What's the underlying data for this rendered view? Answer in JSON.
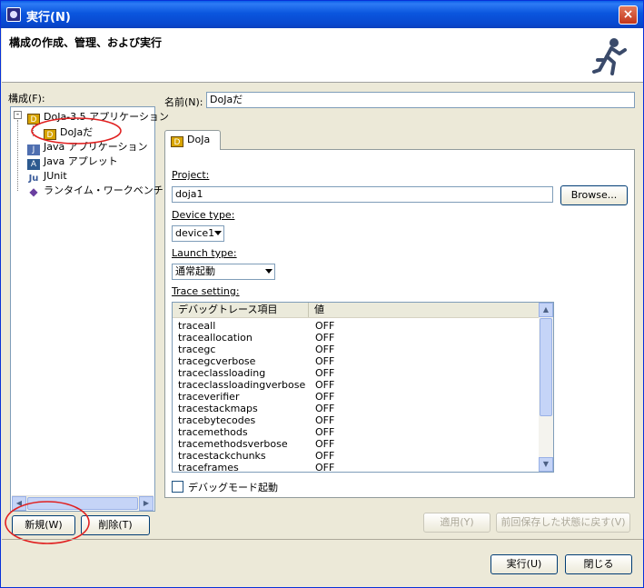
{
  "window": {
    "title": "実行(N)",
    "close": "×"
  },
  "banner": {
    "title": "構成の作成、管理、および実行"
  },
  "tree": {
    "label": "構成(F):",
    "items": [
      {
        "label": "DoJa-3.5 アプリケーション",
        "icon": "doja-icon"
      },
      {
        "label": "DoJaだ",
        "icon": "doja-icon"
      },
      {
        "label": "Java アプリケーション",
        "icon": "java-app-icon"
      },
      {
        "label": "Java アプレット",
        "icon": "java-applet-icon"
      },
      {
        "label": "JUnit",
        "icon": "junit-icon"
      },
      {
        "label": "ランタイム・ワークベンチ",
        "icon": "runtime-workbench-icon"
      }
    ]
  },
  "buttons": {
    "new": "新規(W)",
    "delete": "削除(T)",
    "apply": "適用(Y)",
    "revert": "前回保存した状態に戻す(V)",
    "run": "実行(U)",
    "close": "閉じる",
    "browse": "Browse..."
  },
  "name": {
    "label": "名前(N):",
    "value": "DoJaだ"
  },
  "tab": {
    "label": "DoJa"
  },
  "form": {
    "project_label": "Project:",
    "project_value": "doja1",
    "device_label": "Device type:",
    "device_value": "device1",
    "launch_label": "Launch type:",
    "launch_value": "通常起動",
    "trace_label": "Trace setting:",
    "debug_checkbox": "デバッグモード起動"
  },
  "trace_table": {
    "columns": [
      "デバッグトレース項目",
      "値"
    ],
    "rows": [
      [
        "traceall",
        "OFF"
      ],
      [
        "traceallocation",
        "OFF"
      ],
      [
        "tracegc",
        "OFF"
      ],
      [
        "tracegcverbose",
        "OFF"
      ],
      [
        "traceclassloading",
        "OFF"
      ],
      [
        "traceclassloadingverbose",
        "OFF"
      ],
      [
        "traceverifier",
        "OFF"
      ],
      [
        "tracestackmaps",
        "OFF"
      ],
      [
        "tracebytecodes",
        "OFF"
      ],
      [
        "tracemethods",
        "OFF"
      ],
      [
        "tracemethodsverbose",
        "OFF"
      ],
      [
        "tracestackchunks",
        "OFF"
      ],
      [
        "traceframes",
        "OFF"
      ]
    ]
  },
  "colors": {
    "titlebar": "#0a56de",
    "annotation": "#e02020",
    "face": "#ece9d8"
  }
}
